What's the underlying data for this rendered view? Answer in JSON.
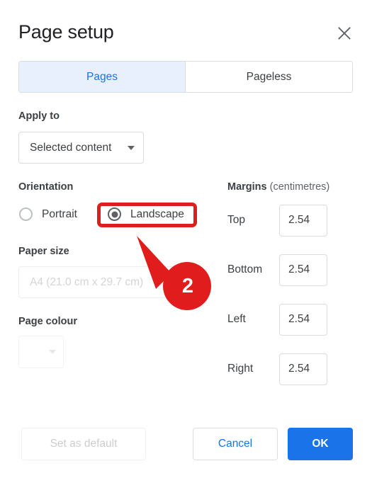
{
  "dialog": {
    "title": "Page setup",
    "close_icon": "close-icon"
  },
  "tabs": [
    {
      "label": "Pages",
      "active": true
    },
    {
      "label": "Pageless",
      "active": false
    }
  ],
  "apply_to": {
    "label": "Apply to",
    "value": "Selected content",
    "caret_icon": "chevron-down-icon"
  },
  "orientation": {
    "label": "Orientation",
    "options": [
      {
        "label": "Portrait",
        "selected": false
      },
      {
        "label": "Landscape",
        "selected": true
      }
    ]
  },
  "paper_size": {
    "label": "Paper size",
    "value": "A4 (21.0 cm x 29.7 cm)",
    "disabled": true,
    "caret_icon": "chevron-down-icon"
  },
  "page_colour": {
    "label": "Page colour",
    "swatch_colour": "#ffffff",
    "caret_icon": "chevron-down-icon"
  },
  "margins": {
    "label": "Margins",
    "unit_label": "(centimetres)",
    "fields": [
      {
        "name": "Top",
        "value": "2.54"
      },
      {
        "name": "Bottom",
        "value": "2.54"
      },
      {
        "name": "Left",
        "value": "2.54"
      },
      {
        "name": "Right",
        "value": "2.54"
      }
    ]
  },
  "footer": {
    "set_as_default": "Set as default",
    "cancel": "Cancel",
    "ok": "OK"
  },
  "annotation": {
    "step_number": "2",
    "colour": "#e01c1c",
    "highlight_target": "Landscape"
  },
  "colors": {
    "accent": "#1a73e8",
    "tab_active_bg": "#e8f0fe",
    "text_primary": "#202124",
    "text_secondary": "#3c4043",
    "border": "#dadce0",
    "annotation_red": "#e01c1c"
  }
}
